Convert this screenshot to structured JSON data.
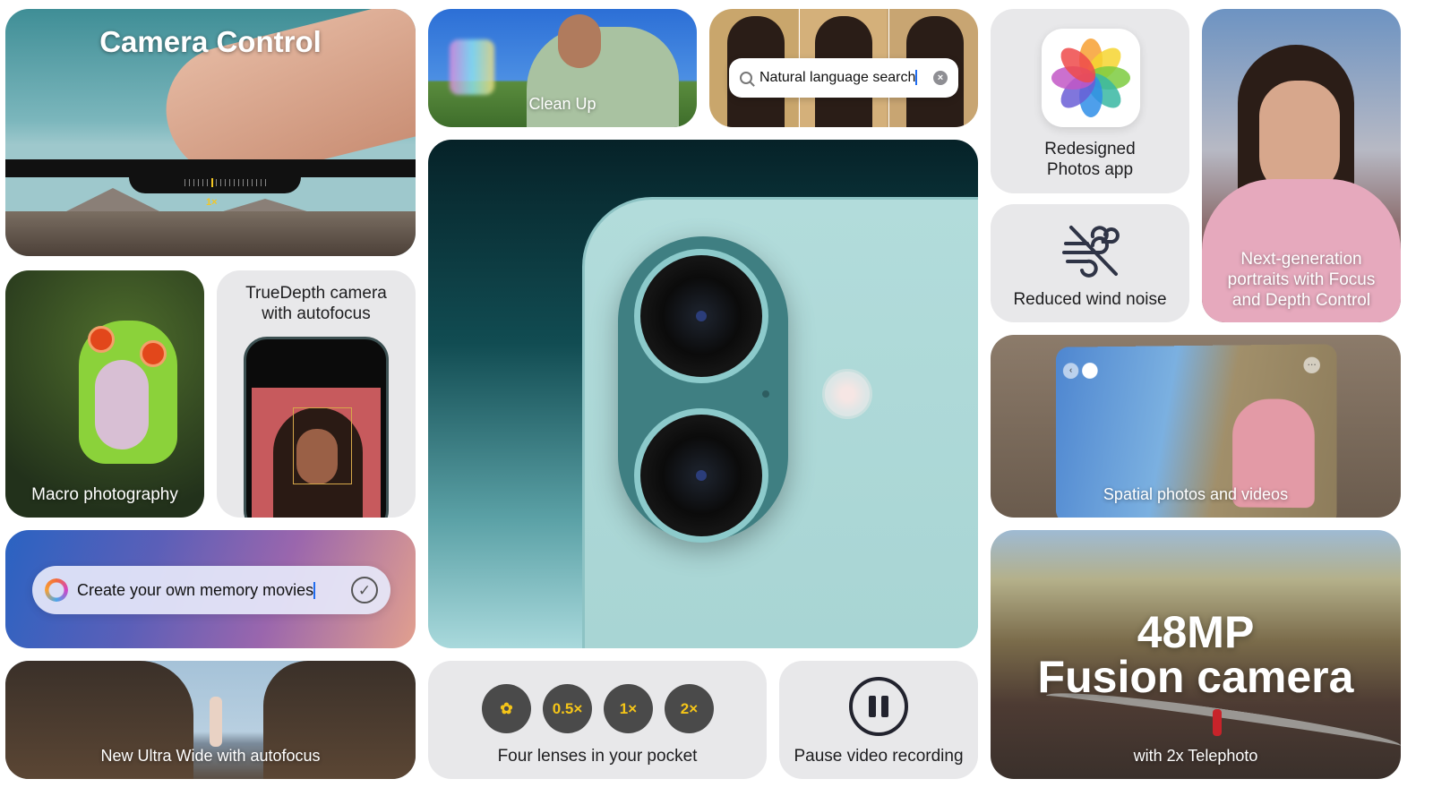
{
  "tiles": {
    "camera_control": {
      "title": "Camera Control",
      "zoom_level": "1×"
    },
    "clean_up": {
      "caption": "Clean Up"
    },
    "search": {
      "value": "Natural language search",
      "clear_icon": "×"
    },
    "photos_app": {
      "caption_line1": "Redesigned",
      "caption_line2": "Photos app"
    },
    "wind_noise": {
      "caption": "Reduced wind noise"
    },
    "portraits": {
      "caption_line1": "Next-generation",
      "caption_line2": "portraits with Focus",
      "caption_line3": "and Depth Control"
    },
    "macro": {
      "caption": "Macro photography"
    },
    "truedepth": {
      "caption_line1": "TrueDepth camera",
      "caption_line2": "with autofocus"
    },
    "memory": {
      "value": "Create your own memory movies",
      "check_icon": "✓"
    },
    "ultra_wide": {
      "caption": "New Ultra Wide with autofocus"
    },
    "spatial": {
      "caption": "Spatial photos and videos",
      "back_icon": "‹",
      "more_icon": "···"
    },
    "fusion": {
      "line1": "48MP",
      "line2": "Fusion camera",
      "subtitle": "with 2x Telephoto"
    },
    "lenses": {
      "caption": "Four lenses in your pocket",
      "options": [
        "✿",
        "0.5×",
        "1×",
        "2×"
      ]
    },
    "pause": {
      "caption": "Pause video recording"
    }
  },
  "colors": {
    "lens_accent": "#f5c518",
    "tile_grey": "#e8e8ea",
    "cursor": "#1f6cf0"
  }
}
